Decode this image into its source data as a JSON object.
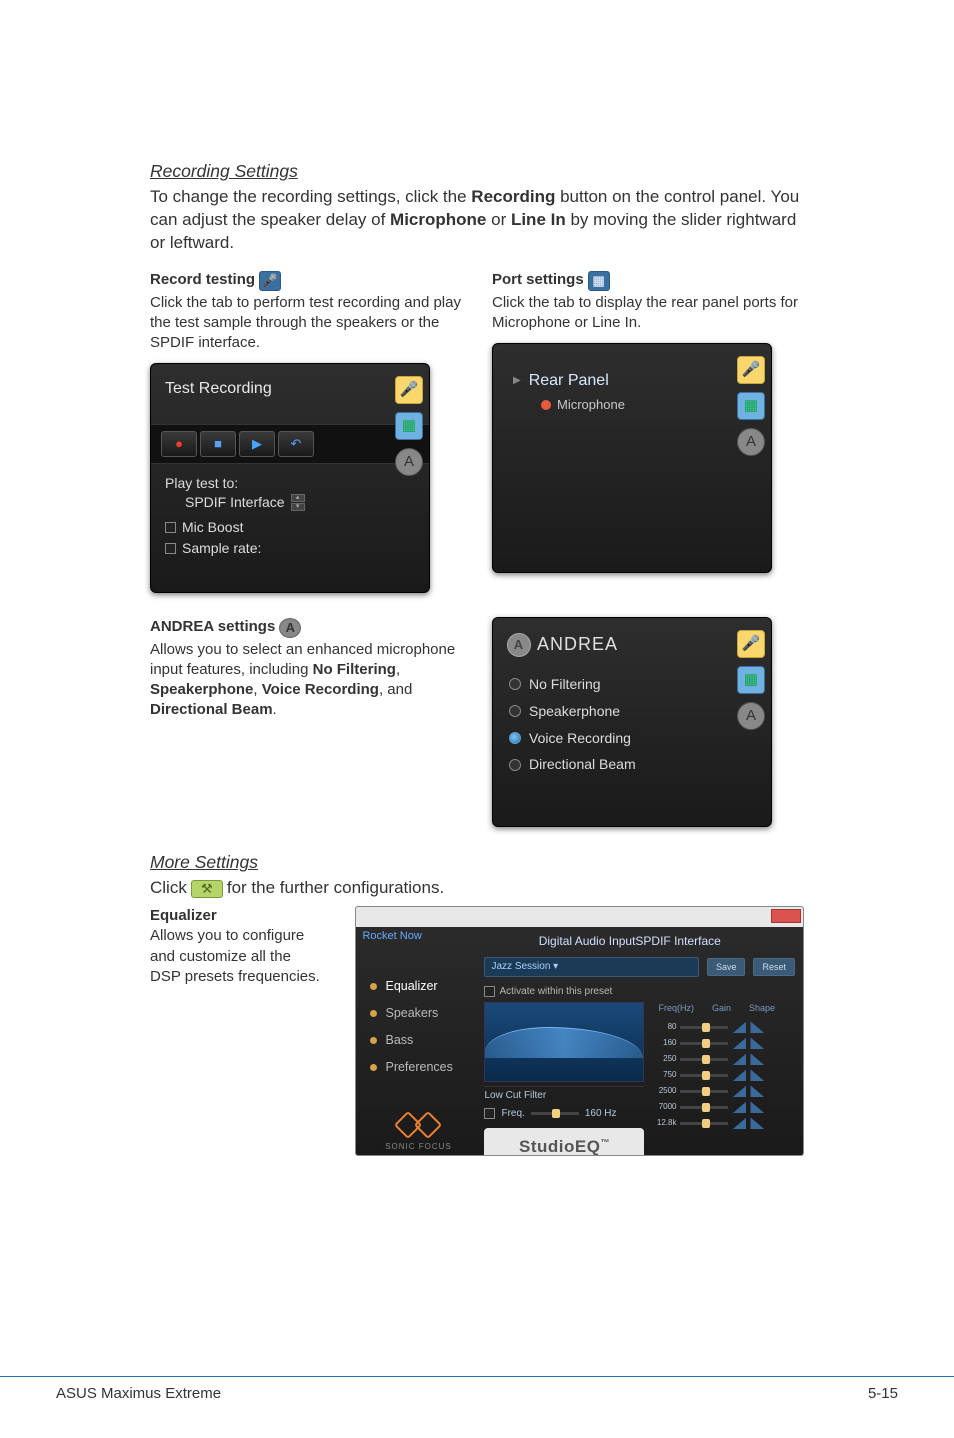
{
  "section1": {
    "heading": "Recording Settings",
    "intro_pre": "To change the recording settings, click the ",
    "intro_bold1": "Recording",
    "intro_mid1": " button on the control panel. You can adjust the speaker delay of ",
    "intro_bold2": "Microphone",
    "intro_mid2": " or ",
    "intro_bold3": "Line In",
    "intro_post": " by moving the slider rightward or leftward."
  },
  "record_testing": {
    "title": "Record testing",
    "desc": "Click the tab to perform test recording and play the test sample through the speakers or the SPDIF interface.",
    "panel_title": "Test Recording",
    "play_test_to": "Play test to:",
    "spdif": "SPDIF Interface",
    "mic_boost": "Mic Boost",
    "sample_rate": "Sample rate:"
  },
  "port_settings": {
    "title": "Port settings",
    "desc": "Click the tab to display the rear panel ports for Microphone or Line In.",
    "panel_title": "Rear Panel",
    "item1": "Microphone"
  },
  "andrea": {
    "title": "ANDREA settings",
    "desc_pre": "Allows you to select an enhanced microphone input features, including ",
    "b1": "No Filtering",
    "sep1": ", ",
    "b2": "Speakerphone",
    "sep2": ", ",
    "b3": "Voice Recording",
    "sep3": ", and ",
    "b4": "Directional Beam",
    "suffix": ".",
    "panel_title": "ANDREA",
    "items": [
      "No Filtering",
      "Speakerphone",
      "Voice Recording",
      "Directional Beam"
    ],
    "selected_index": 2
  },
  "more": {
    "heading": "More Settings",
    "click_pre": "Click ",
    "click_post": " for the further configurations.",
    "eq_title": "Equalizer",
    "eq_desc": "Allows you to configure and customize all the DSP presets frequencies."
  },
  "eq_window": {
    "rocket": "Rocket Now",
    "subtitle": "Digital Audio InputSPDIF Interface",
    "nav": [
      "Equalizer",
      "Speakers",
      "Bass",
      "Preferences"
    ],
    "preset": "Jazz Session",
    "save": "Save",
    "reset": "Reset",
    "activate": "Activate within this preset",
    "headers": [
      "Freq(Hz)",
      "Gain",
      "Shape"
    ],
    "bands": [
      "80",
      "160",
      "250",
      "750",
      "2500",
      "7000",
      "12.8k"
    ],
    "lowcut_label": "Low Cut Filter",
    "lowcut_freq": "Freq.",
    "lowcut_hz": "160 Hz",
    "branding": "StudioEQ",
    "sonic": "SONIC  FOCUS"
  },
  "footer": {
    "left": "ASUS Maximus Extreme",
    "right": "5-15"
  }
}
